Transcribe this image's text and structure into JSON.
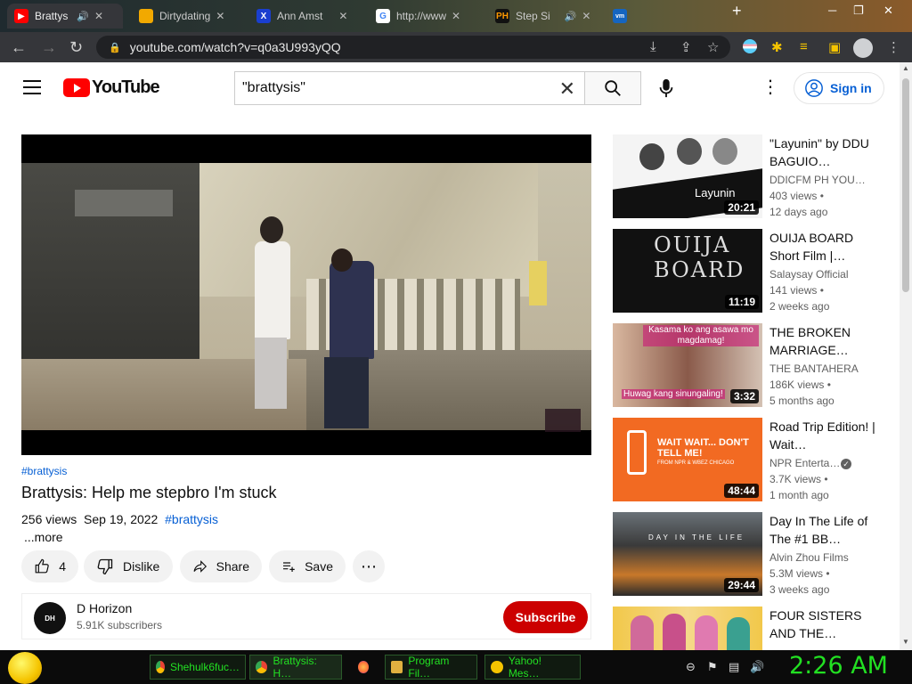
{
  "browser": {
    "tabs": [
      {
        "label": "Brattys",
        "active": true,
        "favicon_color": "#ff0000"
      },
      {
        "label": "Dirtydating",
        "active": false,
        "favicon_color": "#f2a900"
      },
      {
        "label": "Ann Amst",
        "active": false,
        "favicon_color": "#1a3fcf"
      },
      {
        "label": "http://www",
        "active": false,
        "favicon_color": "#ffffff"
      },
      {
        "label": "Step Si",
        "active": false,
        "favicon_color": "#ff9900"
      },
      {
        "label": "",
        "active": false,
        "favicon_color": "#1565c0"
      }
    ],
    "url": "youtube.com/watch?v=q0a3U993yQQ"
  },
  "youtube": {
    "logo_text": "YouTube",
    "search_value": "\"brattysis\"",
    "signin_label": "Sign in"
  },
  "video": {
    "hashtag_top": "#brattysis",
    "title": "Brattysis: Help me stepbro I'm stuck",
    "views": "256 views",
    "date": "Sep 19, 2022",
    "hashtag_inline": "#brattysis",
    "more": "...more",
    "likes": "4",
    "dislike_label": "Dislike",
    "share_label": "Share",
    "save_label": "Save"
  },
  "channel": {
    "name": "D Horizon",
    "subscribers": "5.91K subscribers",
    "subscribe_label": "Subscribe",
    "avatar_text": "DH"
  },
  "suggested": [
    {
      "title": "\"Layunin\" by DDU BAGUIO…",
      "channel": "DDICFM PH YOU…",
      "views": "403 views •",
      "age": "12 days ago",
      "duration": "20:21",
      "thumb_text": "Layunin",
      "verified": false
    },
    {
      "title": "OUIJA BOARD Short Film |…",
      "channel": "Salaysay Official",
      "views": "141 views •",
      "age": "2 weeks ago",
      "duration": "11:19",
      "thumb_text": "OUIJA BOARD",
      "verified": false
    },
    {
      "title": "THE BROKEN MARRIAGE…",
      "channel": "THE BANTAHERA",
      "views": "186K views •",
      "age": "5 months ago",
      "duration": "3:32",
      "thumb_text": "Kasama ko ang asawa mo magdamag!",
      "thumb_text2": "Huwag kang sinungaling!",
      "verified": false
    },
    {
      "title": "Road Trip Edition! | Wait…",
      "channel": "NPR Enterta…",
      "views": "3.7K views •",
      "age": "1 month ago",
      "duration": "48:44",
      "thumb_text": "WAIT WAIT... DON'T TELL ME!",
      "thumb_text2": "FROM NPR & WBEZ CHICAGO",
      "verified": true
    },
    {
      "title": "Day In The Life of The #1 BB…",
      "channel": "Alvin Zhou Films",
      "views": "5.3M views •",
      "age": "3 weeks ago",
      "duration": "29:44",
      "thumb_text": "DAY IN THE LIFE",
      "verified": false
    },
    {
      "title": "FOUR SISTERS AND THE…",
      "channel": "",
      "views": "",
      "age": "",
      "duration": "",
      "thumb_text": "",
      "verified": false
    }
  ],
  "taskbar": {
    "items": [
      {
        "label": "Shehulk6fuc…",
        "favicon_color": "#4caf50"
      },
      {
        "label": "Brattysis: H…",
        "favicon_color": "#4caf50"
      },
      {
        "label": "",
        "favicon_color": "#ff7139"
      },
      {
        "label": "Program Fil…",
        "favicon_color": "#e0b040"
      },
      {
        "label": "Yahoo! Mes…",
        "favicon_color": "#f5c400"
      }
    ],
    "clock": "2:26 AM"
  }
}
